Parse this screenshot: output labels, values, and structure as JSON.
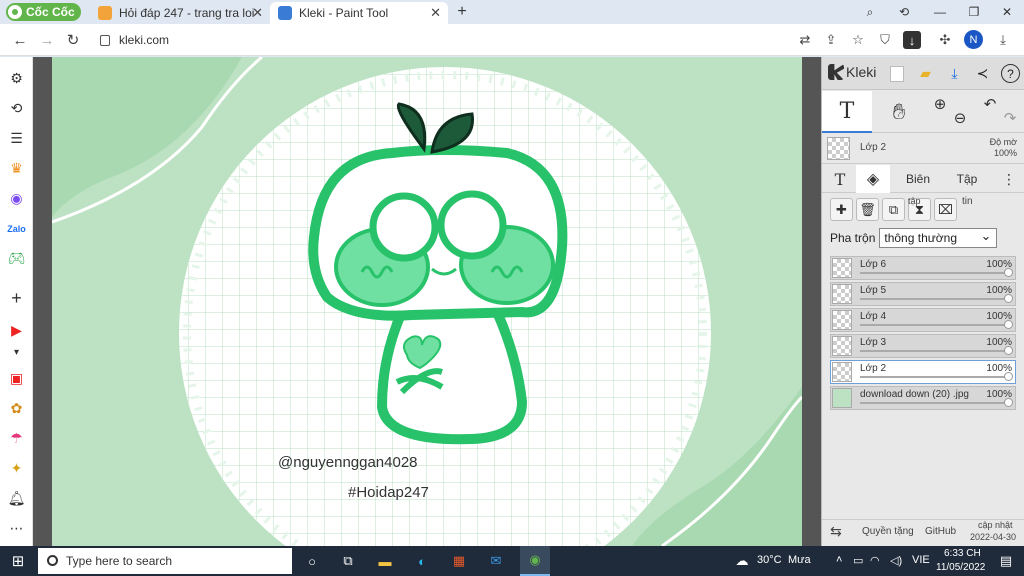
{
  "browser": {
    "brand": "Cốc Cốc",
    "tabs": [
      {
        "title": "Hỏi đáp 247 - trang tra loi",
        "fav_color": "#f2a33a"
      },
      {
        "title": "Kleki - Paint Tool",
        "fav_color": "#3a7bd5"
      }
    ],
    "url": "kleki.com",
    "profile_initial": "N"
  },
  "canvas": {
    "watermark_user": "@nguyennggan4028",
    "watermark_tag": "#Hoidap247",
    "colors": {
      "bg": "#b9dfc0",
      "character_outline": "#27c26a",
      "cheek": "#6fe0a1",
      "leaf": "#1d5a3a"
    }
  },
  "kleki": {
    "title": "Kleki",
    "current_layer": "Lớp 2",
    "opacity_label": "Độ mờ",
    "opacity_value": "100%",
    "tab_adjust": "Biên",
    "tab_file": "Tập",
    "tap_label": "tập",
    "tin_label": "tin",
    "blend_label": "Pha trộn",
    "blend_value": "thông thường",
    "layers": [
      {
        "name": "Lớp 6",
        "opacity": "100%"
      },
      {
        "name": "Lớp 5",
        "opacity": "100%"
      },
      {
        "name": "Lớp 4",
        "opacity": "100%"
      },
      {
        "name": "Lớp 3",
        "opacity": "100%"
      },
      {
        "name": "Lớp 2",
        "opacity": "100%"
      },
      {
        "name": "download down (20) .jpg",
        "opacity": "100%"
      }
    ],
    "footer": {
      "privacy": "Quyền tặng",
      "github": "GitHub",
      "updated_label": "cập nhật",
      "updated_date": "2022-04-30"
    }
  },
  "taskbar": {
    "search_placeholder": "Type here to search",
    "temperature": "30°C",
    "weather": "Mưa",
    "lang": "VIE",
    "time": "6:33 CH",
    "date": "11/05/2022"
  }
}
